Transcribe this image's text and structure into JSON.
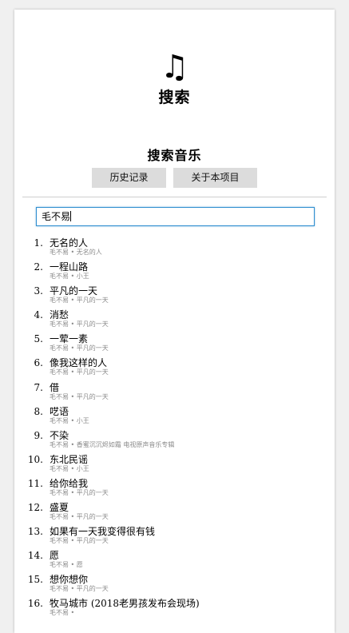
{
  "header": {
    "logo_glyph": "♫",
    "title": "搜索"
  },
  "search_section": {
    "title": "搜索音乐",
    "history_button": "历史记录",
    "about_button": "关于本项目",
    "query": "毛不易"
  },
  "results": [
    {
      "num": "1.",
      "title": "无名的人",
      "meta": "毛不易 • 无名的人"
    },
    {
      "num": "2.",
      "title": "一程山路",
      "meta": "毛不易 • 小王"
    },
    {
      "num": "3.",
      "title": "平凡的一天",
      "meta": "毛不易 • 平凡的一天"
    },
    {
      "num": "4.",
      "title": "消愁",
      "meta": "毛不易 • 平凡的一天"
    },
    {
      "num": "5.",
      "title": "一荤一素",
      "meta": "毛不易 • 平凡的一天"
    },
    {
      "num": "6.",
      "title": "像我这样的人",
      "meta": "毛不易 • 平凡的一天"
    },
    {
      "num": "7.",
      "title": "借",
      "meta": "毛不易 • 平凡的一天"
    },
    {
      "num": "8.",
      "title": "呓语",
      "meta": "毛不易 • 小王"
    },
    {
      "num": "9.",
      "title": "不染",
      "meta": "毛不易 • 香蜜沉沉烬如霜 电视原声音乐专辑"
    },
    {
      "num": "10.",
      "title": "东北民谣",
      "meta": "毛不易 • 小王"
    },
    {
      "num": "11.",
      "title": "给你给我",
      "meta": "毛不易 • 平凡的一天"
    },
    {
      "num": "12.",
      "title": "盛夏",
      "meta": "毛不易 • 平凡的一天"
    },
    {
      "num": "13.",
      "title": "如果有一天我变得很有钱",
      "meta": "毛不易 • 平凡的一天"
    },
    {
      "num": "14.",
      "title": "愿",
      "meta": "毛不易 • 愿"
    },
    {
      "num": "15.",
      "title": "想你想你",
      "meta": "毛不易 • 平凡的一天"
    },
    {
      "num": "16.",
      "title": "牧马城市 (2018老男孩发布会现场)",
      "meta": "毛不易 •"
    }
  ]
}
